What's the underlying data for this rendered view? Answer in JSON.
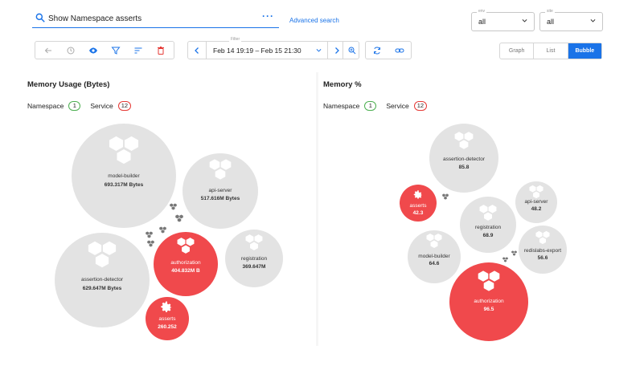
{
  "search": {
    "value": "Show Namespace asserts",
    "more_label": "···",
    "advanced_label": "Advanced search"
  },
  "env_select": {
    "label": "env",
    "value": "all"
  },
  "site_select": {
    "label": "site",
    "value": "all"
  },
  "timebar": {
    "label": "Filter",
    "value": "Feb 14 19:19 – Feb 15 21:30"
  },
  "views": {
    "graph": "Graph",
    "list": "List",
    "bubble": "Bubble"
  },
  "colors": {
    "accent": "#1a73e8",
    "bubble_grey": "#e3e3e3",
    "bubble_red": "#f0494c",
    "namespace_green": "#4caf50",
    "service_red": "#e53935"
  },
  "icons": [
    "search-icon",
    "more-icon",
    "chevron-down-icon",
    "arrow-left-icon",
    "history-icon",
    "eye-icon",
    "filter-icon",
    "sort-icon",
    "trash-icon",
    "chevron-left-icon",
    "chevron-right-icon",
    "zoom-in-icon",
    "sync-icon",
    "link-icon",
    "cubes-icon",
    "gear-icon"
  ],
  "legend": {
    "namespace_label": "Namespace",
    "namespace_count": "1",
    "service_label": "Service",
    "service_count": "12"
  },
  "left_panel": {
    "title": "Memory Usage (Bytes)",
    "bubbles": [
      {
        "name": "model-builder",
        "value": "693.317M Bytes",
        "alert": false
      },
      {
        "name": "api-server",
        "value": "517.616M Bytes",
        "alert": false
      },
      {
        "name": "assertion-detector",
        "value": "629.647M Bytes",
        "alert": false
      },
      {
        "name": "authorization",
        "value": "404.832M B",
        "alert": true
      },
      {
        "name": "registration",
        "value": "369.647M",
        "alert": false
      },
      {
        "name": "asserts",
        "value": "260.252",
        "alert": true
      }
    ]
  },
  "right_panel": {
    "title": "Memory %",
    "bubbles": [
      {
        "name": "assertion-detector",
        "value": "85.8",
        "alert": false
      },
      {
        "name": "asserts",
        "value": "42.3",
        "alert": true
      },
      {
        "name": "api-server",
        "value": "48.2",
        "alert": false
      },
      {
        "name": "registration",
        "value": "68.9",
        "alert": false
      },
      {
        "name": "model-builder",
        "value": "64.6",
        "alert": false
      },
      {
        "name": "redislabs-export",
        "value": "56.6",
        "alert": false
      },
      {
        "name": "authorization",
        "value": "96.5",
        "alert": true
      }
    ]
  }
}
